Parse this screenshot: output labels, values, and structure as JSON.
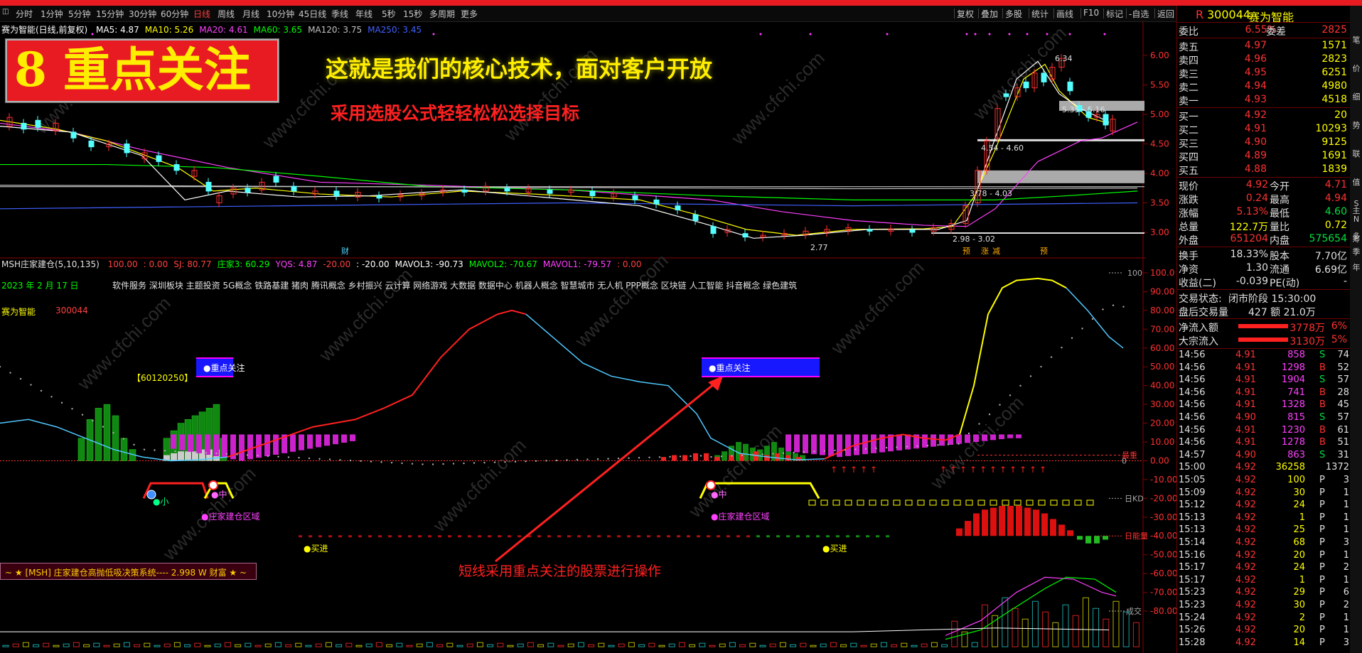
{
  "toolbar": {
    "periods": [
      "分时",
      "1分钟",
      "5分钟",
      "15分钟",
      "30分钟",
      "60分钟",
      "日线",
      "周线",
      "月线",
      "10分钟",
      "45日线",
      "季线",
      "年线",
      "5秒",
      "15秒",
      "多周期",
      "更多"
    ],
    "active_period": "日线",
    "right_tools": [
      "复权",
      "叠加",
      "多股",
      "统计",
      "画线",
      "F10",
      "标记",
      "-自选",
      "返回"
    ]
  },
  "main_chart": {
    "title": "赛为智能(日线,前复权)",
    "ma": [
      {
        "label": "MA5: 4.87",
        "color": "#ffffff"
      },
      {
        "label": "MA10: 5.26",
        "color": "#ffff00"
      },
      {
        "label": "MA20: 4.61",
        "color": "#ff40ff"
      },
      {
        "label": "MA60: 3.65",
        "color": "#00ff00"
      },
      {
        "label": "MA120: 3.75",
        "color": "#c0c0c0"
      },
      {
        "label": "MA250: 3.45",
        "color": "#4060ff"
      }
    ],
    "banner_text": "8 重点关注",
    "headline1": "这就是我们的核心技术，面对客户开放",
    "headline2": "采用选股公式轻轻松松选择目标",
    "y_ticks": [
      "6.00",
      "5.50",
      "5.00",
      "4.50",
      "4.00",
      "3.50",
      "3.00"
    ],
    "annotations": {
      "high": "6.34",
      "p1": "5.35",
      "p2": "5.16",
      "zone1": "4.54 - 4.60",
      "zone2": "3.78 - 4.03",
      "zone3": "2.98 - 3.02",
      "low": "2.77"
    },
    "markers": [
      "财",
      "预",
      "涨",
      "减",
      "预"
    ]
  },
  "indicator": {
    "header_name": "MSH庄家建仓(5,10,135)",
    "header_values": [
      {
        "label": "100.00",
        "color": "#ff4040"
      },
      {
        "label": ": 0.00",
        "color": "#ff4040"
      },
      {
        "label": "SJ: 80.77",
        "color": "#ff4040"
      },
      {
        "label": "庄家3: 60.29",
        "color": "#00ff00"
      },
      {
        "label": "YQS: 4.87",
        "color": "#ff40ff"
      },
      {
        "label": "-20.00",
        "color": "#ff4040"
      },
      {
        "label": ": -20.00",
        "color": "#ffffff"
      },
      {
        "label": "MAVOL3: -90.73",
        "color": "#ffffff"
      },
      {
        "label": "MAVOL2: -70.67",
        "color": "#00ff00"
      },
      {
        "label": "MAVOL1: -79.57",
        "color": "#ff40ff"
      },
      {
        "label": ": 0.00",
        "color": "#ff4040"
      }
    ],
    "date": "2023 年 2 月 17 日",
    "concepts": "软件服务 深圳板块 主题投资 5G概念 铁路基建 猪肉 腾讯概念 乡村振兴 云计算 网络游戏 大数据 数据中心 机器人概念 智慧城市 无人机 PPP概念 区块链 人工智能 抖音概念 绿色建筑",
    "stock_name": "赛为智能",
    "stock_code": "300044",
    "code_box": "【60120250】",
    "focus_label": "●重点关注",
    "small_label": "●小",
    "mid_label": "●中",
    "zone_label": "●庄家建仓区域",
    "buy_label": "●买进",
    "bottom_bar": "~ ★ [MSH] 庄家建仓高抛低吸决策系统----  2.998 W    财富 ★ ~",
    "red_caption": "短线采用重点关注的股票进行操作",
    "y_ticks": [
      "100.0",
      "90.00",
      "80.00",
      "70.00",
      "60.00",
      "50.00",
      "40.00",
      "30.00",
      "20.00",
      "10.00",
      "0.00",
      "-10.00",
      "-20.00",
      "-30.00",
      "-40.00",
      "-50.00",
      "-60.00",
      "-70.00",
      "-80.00"
    ],
    "side_marks": {
      "top": "100",
      "zero": "0",
      "hz": "最重",
      "kd": "日KD",
      "nl": "日能量",
      "cj": "成交"
    },
    "watermark": "www.cfchi.com"
  },
  "quote": {
    "code": "300044",
    "name": "赛为智能",
    "weibi_label": "委比",
    "weibi": "6.55%",
    "weicha_label": "委差",
    "weicha": "2825",
    "sell": [
      {
        "label": "卖五",
        "price": "4.97",
        "vol": "1571"
      },
      {
        "label": "卖四",
        "price": "4.96",
        "vol": "2823"
      },
      {
        "label": "卖三",
        "price": "4.95",
        "vol": "6251"
      },
      {
        "label": "卖二",
        "price": "4.94",
        "vol": "4980"
      },
      {
        "label": "卖一",
        "price": "4.93",
        "vol": "4518"
      }
    ],
    "buy": [
      {
        "label": "买一",
        "price": "4.92",
        "vol": "20"
      },
      {
        "label": "买二",
        "price": "4.91",
        "vol": "10293"
      },
      {
        "label": "买三",
        "price": "4.90",
        "vol": "9125"
      },
      {
        "label": "买四",
        "price": "4.89",
        "vol": "1691"
      },
      {
        "label": "买五",
        "price": "4.88",
        "vol": "1839"
      }
    ],
    "stats": [
      {
        "l1": "现价",
        "v1": "4.92",
        "c1": "#ff3232",
        "l2": "今开",
        "v2": "4.71",
        "c2": "#ff3232"
      },
      {
        "l1": "涨跌",
        "v1": "0.24",
        "c1": "#ff3232",
        "l2": "最高",
        "v2": "4.94",
        "c2": "#ff3232"
      },
      {
        "l1": "涨幅",
        "v1": "5.13%",
        "c1": "#ff3232",
        "l2": "最低",
        "v2": "4.60",
        "c2": "#00e040"
      },
      {
        "l1": "总量",
        "v1": "122.7万",
        "c1": "#ffff00",
        "l2": "量比",
        "v2": "0.72",
        "c2": "#ffff00"
      },
      {
        "l1": "外盘",
        "v1": "651204",
        "c1": "#ff3232",
        "l2": "内盘",
        "v2": "575654",
        "c2": "#00e040"
      }
    ],
    "stats2": [
      {
        "l1": "换手",
        "v1": "18.33%",
        "l2": "股本",
        "v2": "7.70亿"
      },
      {
        "l1": "净资",
        "v1": "1.30",
        "l2": "流通",
        "v2": "6.69亿"
      },
      {
        "l1": "收益(二)",
        "v1": "-0.039",
        "l2": "PE(动)",
        "v2": "-"
      }
    ],
    "status_label": "交易状态:",
    "status": "闭市阶段 15:30:00",
    "after_label": "盘后交易量",
    "after": "427 额 21.0万",
    "inflow": [
      {
        "label": "净流入额",
        "value": "3778万",
        "pct": "6%"
      },
      {
        "label": "大宗流入",
        "value": "3130万",
        "pct": "5%"
      }
    ],
    "trades": [
      {
        "t": "14:56",
        "p": "4.91",
        "v": "858",
        "s": "S",
        "n": "74"
      },
      {
        "t": "14:56",
        "p": "4.91",
        "v": "1298",
        "s": "B",
        "n": "52"
      },
      {
        "t": "14:56",
        "p": "4.91",
        "v": "1904",
        "s": "S",
        "n": "57"
      },
      {
        "t": "14:56",
        "p": "4.91",
        "v": "741",
        "s": "B",
        "n": "28"
      },
      {
        "t": "14:56",
        "p": "4.91",
        "v": "1328",
        "s": "B",
        "n": "45"
      },
      {
        "t": "14:56",
        "p": "4.90",
        "v": "815",
        "s": "S",
        "n": "57"
      },
      {
        "t": "14:56",
        "p": "4.91",
        "v": "1230",
        "s": "B",
        "n": "61"
      },
      {
        "t": "14:56",
        "p": "4.91",
        "v": "1278",
        "s": "B",
        "n": "51"
      },
      {
        "t": "14:57",
        "p": "4.90",
        "v": "863",
        "s": "S",
        "n": "31"
      },
      {
        "t": "15:00",
        "p": "4.92",
        "v": "36258",
        "s": "",
        "n": "1372"
      },
      {
        "t": "15:05",
        "p": "4.92",
        "v": "100",
        "s": "P",
        "n": "3"
      },
      {
        "t": "15:09",
        "p": "4.92",
        "v": "30",
        "s": "P",
        "n": "1"
      },
      {
        "t": "15:12",
        "p": "4.92",
        "v": "24",
        "s": "P",
        "n": "1"
      },
      {
        "t": "15:13",
        "p": "4.92",
        "v": "1",
        "s": "P",
        "n": "1"
      },
      {
        "t": "15:13",
        "p": "4.92",
        "v": "25",
        "s": "P",
        "n": "1"
      },
      {
        "t": "15:14",
        "p": "4.92",
        "v": "68",
        "s": "P",
        "n": "3"
      },
      {
        "t": "15:16",
        "p": "4.92",
        "v": "20",
        "s": "P",
        "n": "1"
      },
      {
        "t": "15:17",
        "p": "4.92",
        "v": "24",
        "s": "P",
        "n": "2"
      },
      {
        "t": "15:17",
        "p": "4.92",
        "v": "1",
        "s": "P",
        "n": "1"
      },
      {
        "t": "15:23",
        "p": "4.92",
        "v": "29",
        "s": "P",
        "n": "6"
      },
      {
        "t": "15:23",
        "p": "4.92",
        "v": "30",
        "s": "P",
        "n": "2"
      },
      {
        "t": "15:24",
        "p": "4.92",
        "v": "2",
        "s": "P",
        "n": "1"
      },
      {
        "t": "15:26",
        "p": "4.92",
        "v": "20",
        "s": "P",
        "n": "1"
      },
      {
        "t": "15:28",
        "p": "4.92",
        "v": "14",
        "s": "P",
        "n": "3"
      }
    ],
    "side_tabs": [
      "笔",
      "价",
      "细",
      "势",
      "联",
      "值",
      "主",
      "筹",
      "S",
      "N",
      "多",
      "季",
      "年"
    ]
  }
}
